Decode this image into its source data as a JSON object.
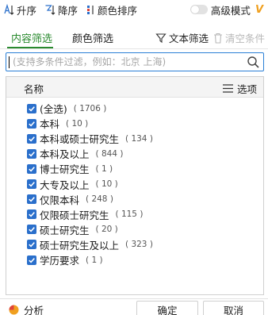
{
  "toolbar": {
    "sort_asc": "升序",
    "sort_desc": "降序",
    "color_sort": "颜色排序",
    "advanced_mode": "高级模式",
    "advanced_badge": "V"
  },
  "tabs": {
    "content_filter": "内容筛选",
    "color_filter": "颜色筛选",
    "text_filter": "文本筛选",
    "clear_conditions": "清空条件"
  },
  "search": {
    "placeholder": "(支持多条件过滤，例如：北京 上海)",
    "value": ""
  },
  "list": {
    "column_name": "名称",
    "options_label": "选项",
    "items": [
      {
        "label": "(全选)",
        "count": "( 1706 )",
        "checked": true
      },
      {
        "label": "本科",
        "count": "( 10 )",
        "checked": true
      },
      {
        "label": "本科或硕士研究生",
        "count": "( 134 )",
        "checked": true
      },
      {
        "label": "本科及以上",
        "count": "( 844 )",
        "checked": true
      },
      {
        "label": "博士研究生",
        "count": "( 1 )",
        "checked": true
      },
      {
        "label": "大专及以上",
        "count": "( 10 )",
        "checked": true
      },
      {
        "label": "仅限本科",
        "count": "( 248 )",
        "checked": true
      },
      {
        "label": "仅限硕士研究生",
        "count": "( 115 )",
        "checked": true
      },
      {
        "label": "硕士研究生",
        "count": "( 20 )",
        "checked": true
      },
      {
        "label": "硕士研究生及以上",
        "count": "( 323 )",
        "checked": true
      },
      {
        "label": "学历要求",
        "count": "( 1 )",
        "checked": true
      }
    ]
  },
  "bottom": {
    "analysis": "分析",
    "confirm": "确定",
    "cancel": "取消"
  },
  "colors": {
    "accent_green": "#2a8a2f",
    "checkbox_blue": "#2a6fcb",
    "focus_border": "#2a7fd6",
    "badge_orange": "#f0a020"
  }
}
